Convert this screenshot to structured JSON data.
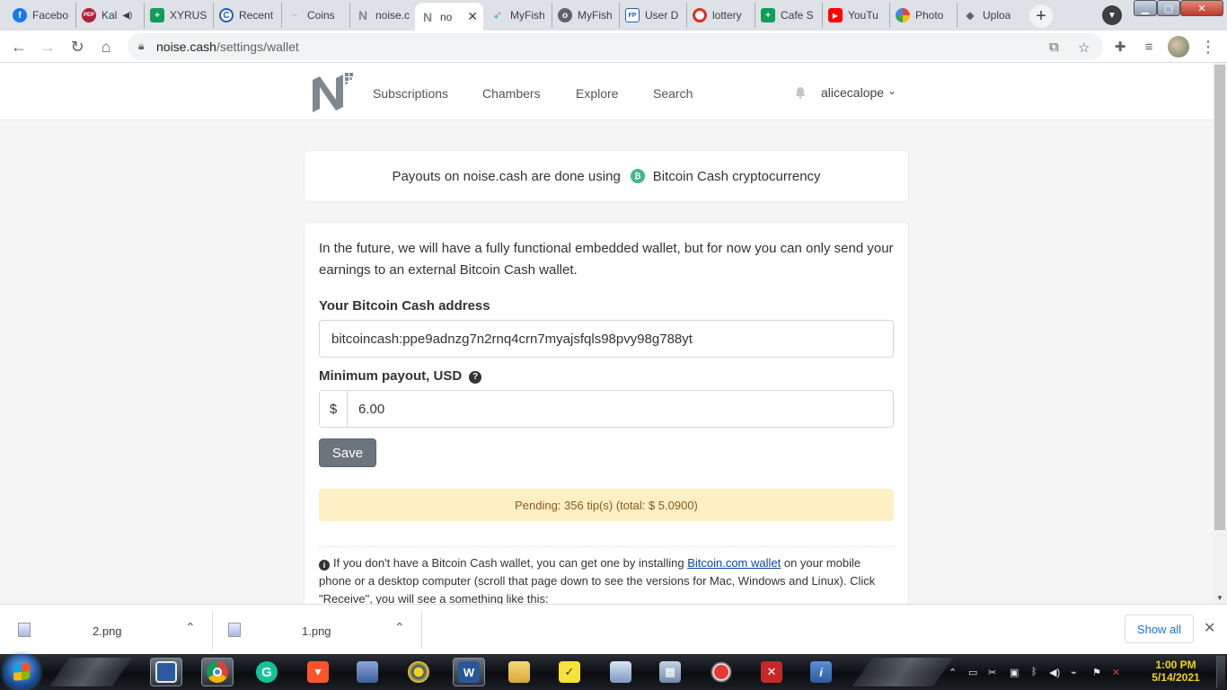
{
  "browser": {
    "tabs": [
      {
        "label": "Facebo",
        "icon": "facebook-icon",
        "color": "#1877f2",
        "glyph": "f"
      },
      {
        "label": "Kal",
        "icon": "pep-icon",
        "color": "#b0203a",
        "glyph": "PEP"
      },
      {
        "label": "XYRUS",
        "icon": "sheets-icon",
        "color": "#0f9d58",
        "glyph": "+"
      },
      {
        "label": "Recent",
        "icon": "coin-icon",
        "color": "#1f5fbf",
        "glyph": "C"
      },
      {
        "label": "Coins",
        "icon": "coins-icon",
        "color": "#9fb6c9",
        "glyph": "~"
      },
      {
        "label": "noise.c",
        "icon": "noise-icon",
        "color": "#7d8890",
        "glyph": "N"
      },
      {
        "label": "no",
        "icon": "noise-icon",
        "color": "#7d8890",
        "glyph": "N"
      },
      {
        "label": "MyFish",
        "icon": "fish-icon",
        "color": "#4aa3d8",
        "glyph": "~"
      },
      {
        "label": "MyFish",
        "icon": "globe-icon",
        "color": "#5f6368",
        "glyph": "o"
      },
      {
        "label": "User D",
        "icon": "fp-icon",
        "color": "#1f5fbf",
        "glyph": "FP"
      },
      {
        "label": "lottery",
        "icon": "lottery-icon",
        "color": "#d93025",
        "glyph": "o"
      },
      {
        "label": "Cafe S",
        "icon": "sheets-icon",
        "color": "#0f9d58",
        "glyph": "+"
      },
      {
        "label": "YouTu",
        "icon": "youtube-icon",
        "color": "#ff0000",
        "glyph": "▶"
      },
      {
        "label": "Photo",
        "icon": "photos-icon",
        "color": "#f4b400",
        "glyph": "✿"
      },
      {
        "label": "Uploa",
        "icon": "upload-icon",
        "color": "#5f6368",
        "glyph": "◆"
      }
    ],
    "active_tab_index": 6,
    "new_tab_label": "+",
    "url_host": "noise.cash",
    "url_path": "/settings/wallet"
  },
  "site": {
    "nav": [
      "Subscriptions",
      "Chambers",
      "Explore",
      "Search"
    ],
    "username": "alicecalope"
  },
  "banner": {
    "text": "Payouts on noise.cash are done using",
    "bch_glyph": "₿",
    "link": "Bitcoin Cash cryptocurrency"
  },
  "wallet": {
    "intro": "In the future, we will have a fully functional embedded wallet, but for now you can only send your earnings to an external Bitcoin Cash wallet.",
    "address_label": "Your Bitcoin Cash address",
    "address_value": "bitcoincash:ppe9adnzg7n2rnq4crn7myajsfqls98pvy98g788yt",
    "min_payout_label": "Minimum payout, USD",
    "currency_symbol": "$",
    "min_payout_value": "6.00",
    "save_label": "Save",
    "pending": "Pending: 356 tip(s) (total: $ 5.0900)",
    "info_before": "If you don't have a Bitcoin Cash wallet, you can get one by installing",
    "info_link": "Bitcoin.com wallet",
    "info_after": "on your mobile phone or a desktop computer (scroll that page down to see the versions for Mac, Windows and Linux). Click \"Receive\", you will see a something like this:"
  },
  "downloads": {
    "items": [
      "2.png",
      "1.png"
    ],
    "show_all": "Show all"
  },
  "taskbar": {
    "time": "1:00 PM",
    "date": "5/14/2021"
  },
  "colors": {
    "bch_green": "#3fb68b",
    "pending_bg": "#fcf0c4",
    "save_bg": "#6c757d",
    "link_blue": "#0645ad"
  }
}
